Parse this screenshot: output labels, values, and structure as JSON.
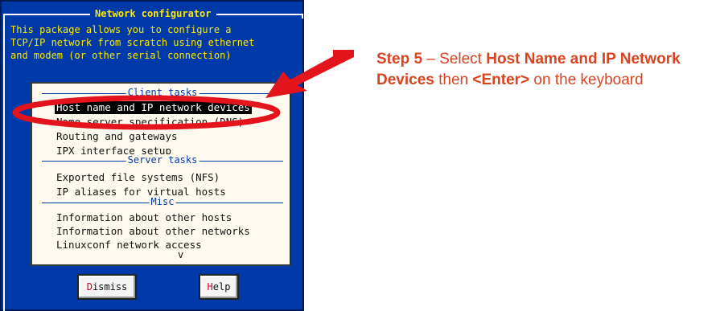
{
  "window": {
    "title": "Network configurator",
    "description": [
      "This package allows you to configure a",
      "TCP/IP network from scratch using ethernet",
      "and modem (or other serial connection)"
    ]
  },
  "menu": {
    "sections": [
      {
        "label": "Client tasks",
        "items": [
          "Host name and IP network devices",
          "Name server specification (DNS)",
          "Routing and gateways",
          "IPX interface setup"
        ],
        "selected_index": 0
      },
      {
        "label": "Server tasks",
        "items": [
          "Exported file systems (NFS)",
          "IP aliases for virtual hosts"
        ]
      },
      {
        "label": "Misc",
        "items": [
          "Information about other hosts",
          "Information about other networks",
          "Linuxconf network access"
        ]
      }
    ],
    "more_indicator": "v"
  },
  "buttons": {
    "dismiss": {
      "hotkey": "D",
      "rest": "ismiss"
    },
    "help": {
      "hotkey": "H",
      "rest": "elp"
    }
  },
  "annotation": {
    "step": "Step 5",
    "dash": " – Select ",
    "target": "Host Name and IP Network Devices",
    "then": " then ",
    "key": "<Enter>",
    "tail": " on the keyboard",
    "highlight_color": "#e3141c",
    "text_color": "#d9431f"
  }
}
